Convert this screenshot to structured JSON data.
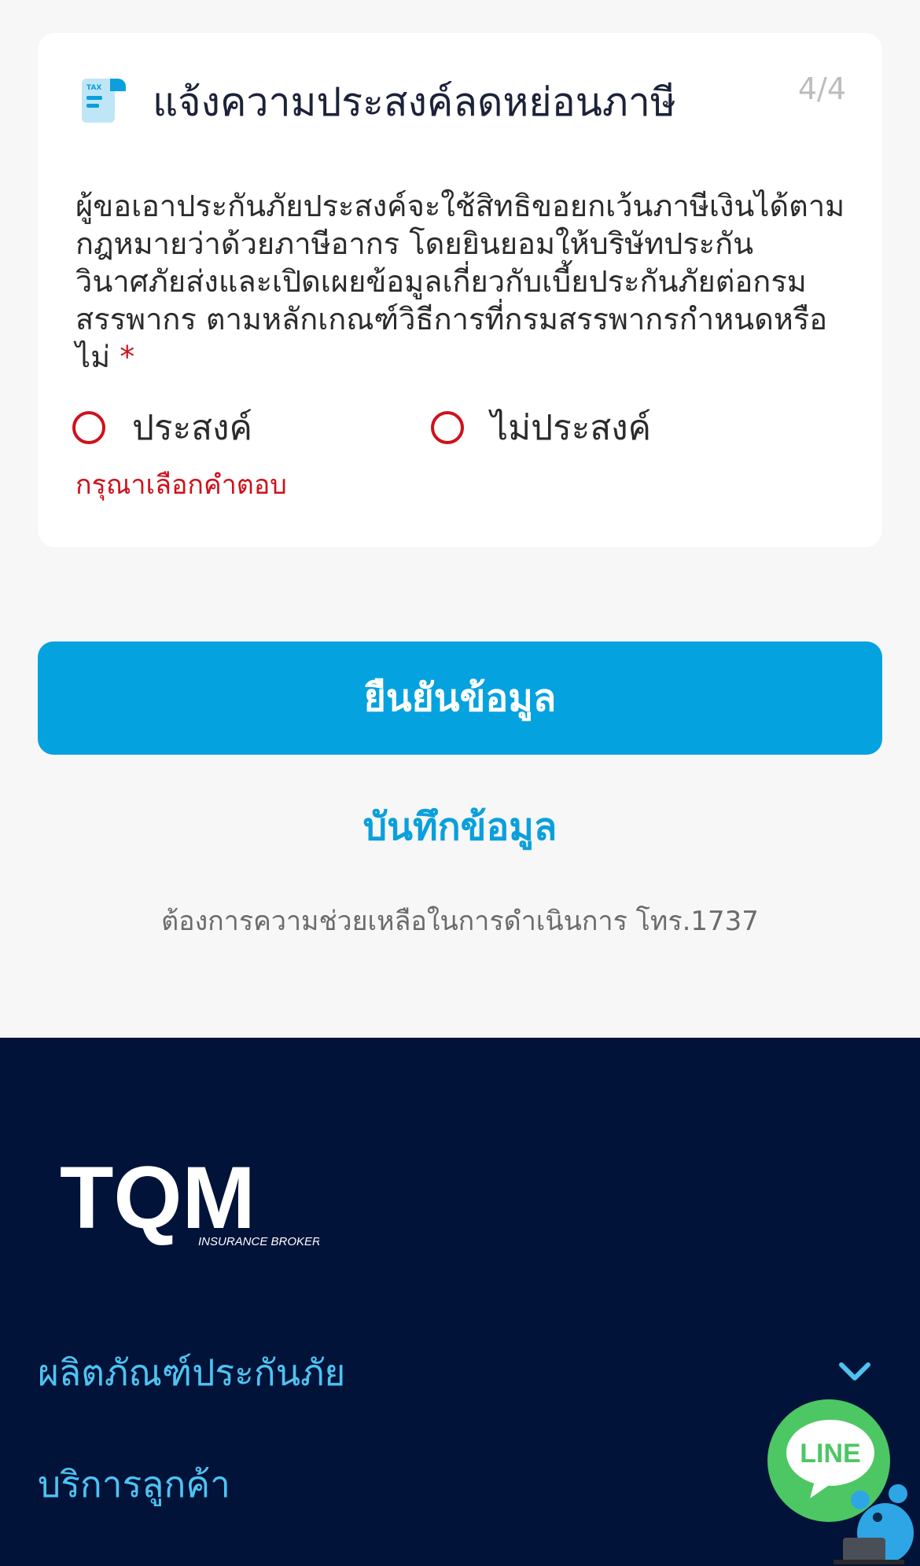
{
  "card": {
    "title": "แจ้งความประสงค์ลดหย่อนภาษี",
    "step": "4/4",
    "icon": "tax-document-icon",
    "question": "ผู้ขอเอาประกันภัยประสงค์จะใช้สิทธิขอยกเว้นภาษีเงินได้ตามกฎหมายว่าด้วยภาษีอากร โดยยินยอมให้บริษัทประกันวินาศภัยส่งและเปิดเผยข้อมูลเกี่ยวกับเบี้ยประกันภัยต่อกรมสรรพากร ตามหลักเกณฑ์วิธีการที่กรมสรรพากรกำหนดหรือไม่",
    "required_mark": "*",
    "options": [
      {
        "label": "ประสงค์",
        "selected": false
      },
      {
        "label": "ไม่ประสงค์",
        "selected": false
      }
    ],
    "error": "กรุณาเลือกคำตอบ"
  },
  "actions": {
    "confirm_label": "ยืนยันข้อมูล",
    "save_label": "บันทึกข้อมูล"
  },
  "help_text": "ต้องการความช่วยเหลือในการดำเนินการ โทร.1737",
  "footer": {
    "logo_text": "TQM",
    "logo_subtext": "INSURANCE BROKER",
    "items": [
      {
        "label": "ผลิตภัณฑ์ประกันภัย"
      },
      {
        "label": "บริการลูกค้า"
      }
    ]
  },
  "line_fab": {
    "label": "LINE"
  },
  "colors": {
    "primary": "#05a2e0",
    "error": "#d0101b",
    "footer_bg": "#011339",
    "footer_link": "#4ec3f2",
    "line_green": "#4cc764"
  }
}
